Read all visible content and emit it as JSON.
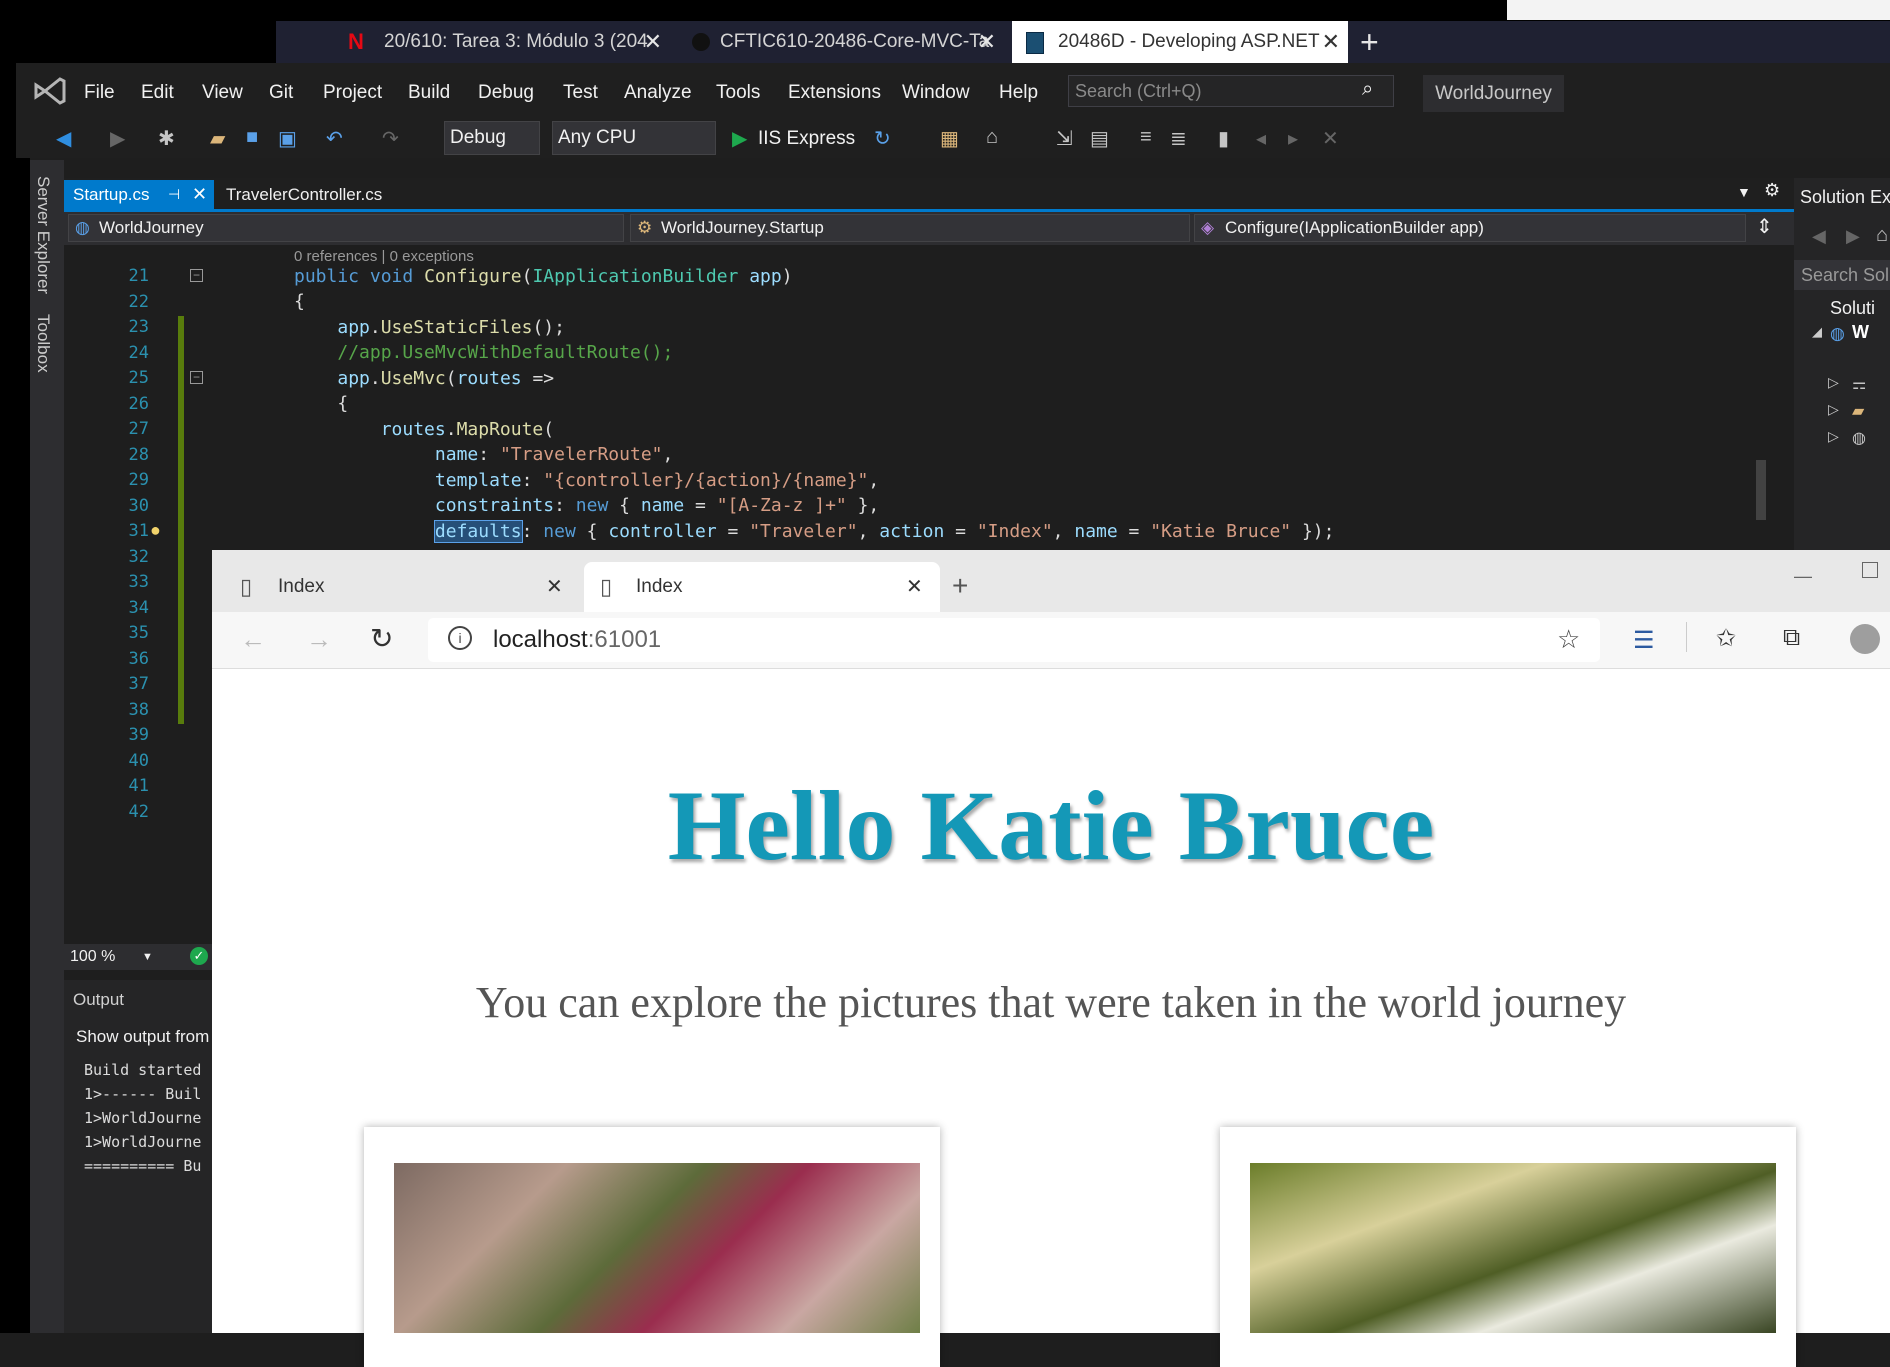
{
  "os_tabs": [
    {
      "label": "20/610: Tarea 3: Módulo 3 (204",
      "close": "✕",
      "icon": "n-logo-icon"
    },
    {
      "label": "CFTIC610-20486-Core-MVC-Ta",
      "close": "✕",
      "icon": "github-icon"
    },
    {
      "label": "20486D - Developing ASP.NET",
      "close": "✕",
      "icon": "book-icon"
    }
  ],
  "os_new_tab": "+",
  "vs": {
    "menu": [
      "File",
      "Edit",
      "View",
      "Git",
      "Project",
      "Build",
      "Debug",
      "Test",
      "Analyze",
      "Tools",
      "Extensions",
      "Window",
      "Help"
    ],
    "search_placeholder": "Search (Ctrl+Q)",
    "solution_title": "WorldJourney",
    "toolbar": {
      "config": "Debug",
      "platform": "Any CPU",
      "run_target": "IIS Express"
    },
    "side_tabs": [
      "Server Explorer",
      "Toolbox"
    ],
    "doc_tabs": [
      "Startup.cs",
      "TravelerController.cs"
    ],
    "nav": {
      "project": "WorldJourney",
      "type": "WorldJourney.Startup",
      "member": "Configure(IApplicationBuilder app)"
    },
    "codelens": "0 references | 0 exceptions",
    "line_numbers": [
      "21",
      "22",
      "23",
      "24",
      "25",
      "26",
      "27",
      "28",
      "29",
      "30",
      "31",
      "32",
      "33",
      "34",
      "35",
      "36",
      "37",
      "38",
      "39",
      "40",
      "41",
      "42"
    ],
    "zoom": "100 %",
    "output_title": "Output",
    "output_show": "Show output from",
    "output_lines": [
      "Build started",
      "1>------ Buil",
      "1>WorldJourne",
      "1>WorldJourne",
      "========== Bu"
    ],
    "solution_explorer": {
      "title": "Solution Ex",
      "search": "Search Solu",
      "root": "Soluti",
      "project": "W"
    }
  },
  "browser": {
    "tabs": [
      "Index",
      "Index"
    ],
    "url_host": "localhost",
    "url_port": ":61001",
    "heading": "Hello Katie Bruce",
    "subtitle": "You can explore the pictures that were taken in the world journey"
  },
  "colors": {
    "vs_accent": "#007acc",
    "heading": "#1498b7"
  }
}
